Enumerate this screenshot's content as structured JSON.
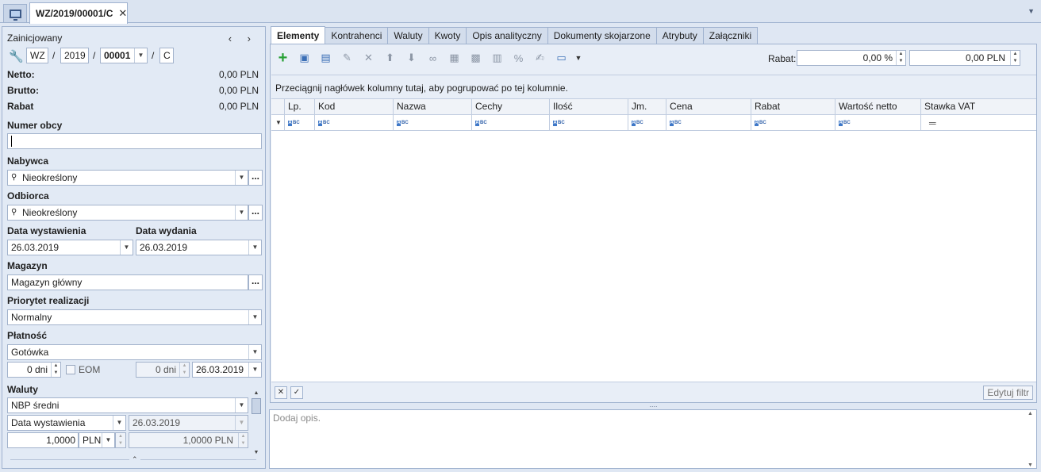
{
  "doc_tab": {
    "title": "WZ/2019/00001/C",
    "close": "✕"
  },
  "left": {
    "status": "Zainicjowany",
    "nav": "‹ ›",
    "number": {
      "series": "WZ",
      "sep1": "/",
      "year": "2019",
      "sep2": "/",
      "num": "00001",
      "sep3": "/",
      "suffix": "C"
    },
    "totals": [
      {
        "label": "Netto:",
        "value": "0,00 PLN"
      },
      {
        "label": "Brutto:",
        "value": "0,00 PLN"
      },
      {
        "label": "Rabat",
        "value": "0,00 PLN"
      }
    ],
    "numer_obcy": {
      "label": "Numer obcy",
      "value": ""
    },
    "nabywca": {
      "label": "Nabywca",
      "value": "Nieokreślony"
    },
    "odbiorca": {
      "label": "Odbiorca",
      "value": "Nieokreślony"
    },
    "data_wystawienia": {
      "label": "Data wystawienia",
      "value": "26.03.2019"
    },
    "data_wydania": {
      "label": "Data wydania",
      "value": "26.03.2019"
    },
    "magazyn": {
      "label": "Magazyn",
      "value": "Magazyn główny"
    },
    "priorytet": {
      "label": "Priorytet realizacji",
      "value": "Normalny"
    },
    "platnosc": {
      "label": "Płatność",
      "value": "Gotówka",
      "days": "0 dni",
      "eom": "EOM",
      "days2": "0 dni",
      "date": "26.03.2019"
    },
    "waluty": {
      "label": "Waluty",
      "rate_type": "NBP średni",
      "date_type": "Data wystawienia",
      "date": "26.03.2019",
      "rate1": "1,0000",
      "cur1": "PLN",
      "rate2": "1,0000 PLN"
    }
  },
  "tabs": [
    "Elementy",
    "Kontrahenci",
    "Waluty",
    "Kwoty",
    "Opis analityczny",
    "Dokumenty skojarzone",
    "Atrybuty",
    "Załączniki"
  ],
  "toolbar": {
    "icons": [
      "add-icon",
      "add-from-list-icon",
      "add-multiple-icon",
      "wrench-icon",
      "delete-icon",
      "move-up-icon",
      "move-down-icon",
      "link-icon",
      "calculator-icon",
      "stock-icon",
      "bar-icon",
      "percent-icon",
      "document-edit-icon",
      "view-icon"
    ],
    "rabat_label": "Rabat:",
    "rabat_percent": "0,00 %",
    "rabat_amount": "0,00 PLN"
  },
  "grid": {
    "group_hint": "Przeciągnij nagłówek kolumny tutaj, aby pogrupować po tej kolumnie.",
    "columns": [
      "Lp.",
      "Kod",
      "Nazwa",
      "Cechy",
      "Ilość",
      "Jm.",
      "Cena",
      "Rabat",
      "Wartość netto",
      "Stawka VAT"
    ],
    "edit_filter": "Edytuj filtr"
  },
  "description": {
    "placeholder": "Dodaj opis."
  },
  "colors": {
    "accent": "#3b6fb6",
    "add": "#27a035",
    "panel": "#e2eaf5",
    "border": "#9fb2cf"
  }
}
